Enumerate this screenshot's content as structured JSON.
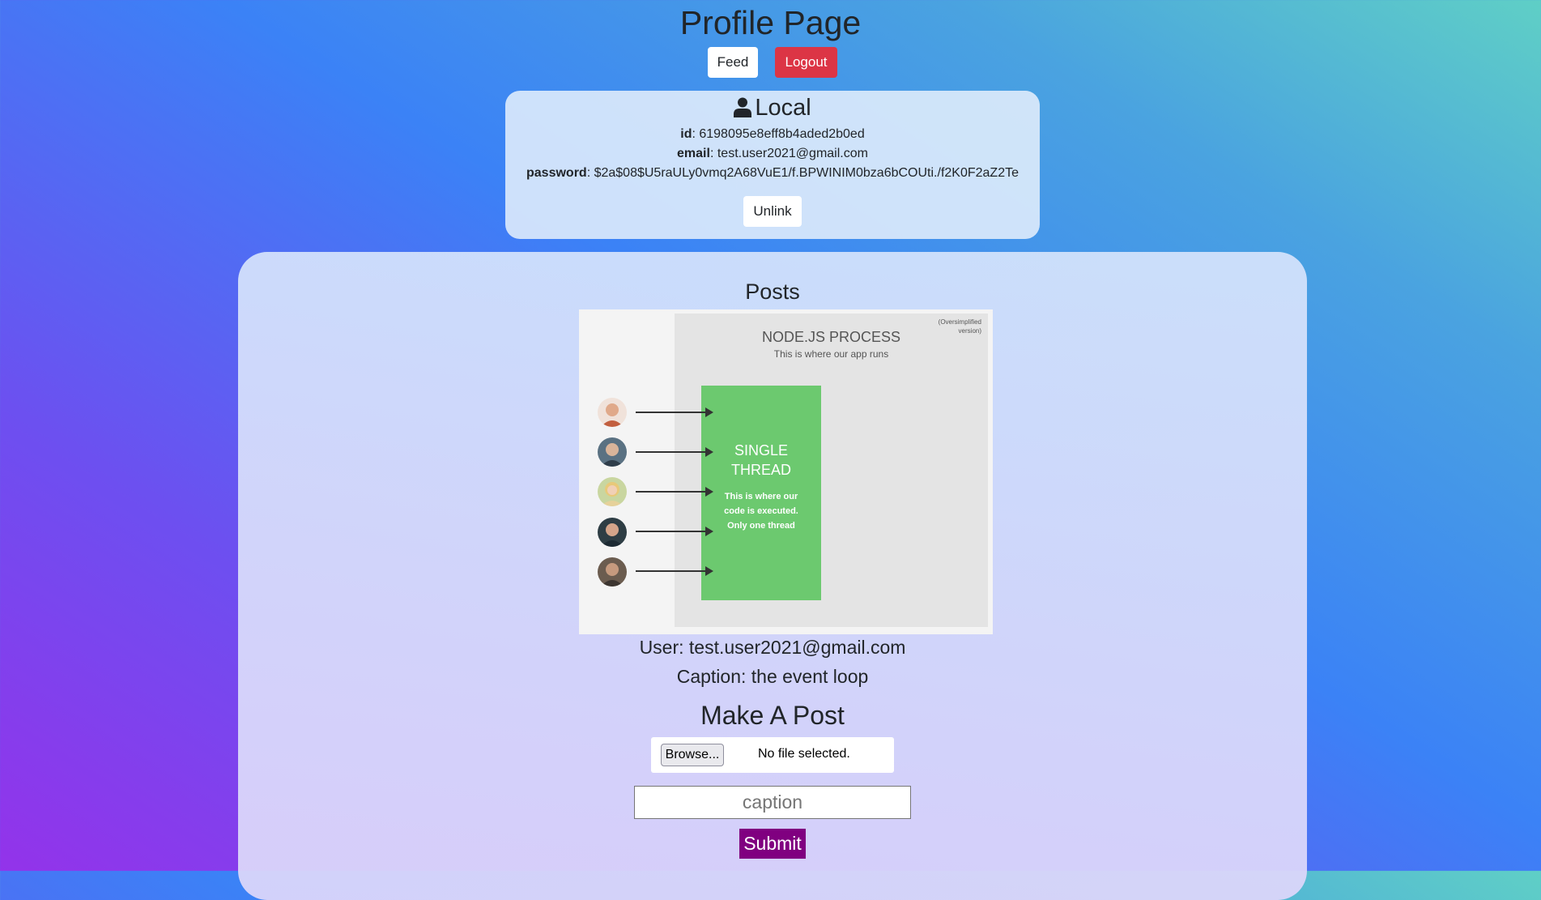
{
  "header": {
    "title": "Profile Page",
    "feed_label": "Feed",
    "logout_label": "Logout"
  },
  "local": {
    "title": "Local",
    "icon": "user-icon",
    "id_label": "id",
    "id_value": "6198095e8eff8b4aded2b0ed",
    "email_label": "email",
    "email_value": "test.user2021@gmail.com",
    "password_label": "password",
    "password_value": "$2a$08$U5raULy0vmq2A68VuE1/f.BPWINIM0bza6bCOUti./f2K0F2aZ2Te",
    "unlink_label": "Unlink"
  },
  "posts": {
    "title": "Posts",
    "items": [
      {
        "image_text": {
          "note": "(Oversimplified version)",
          "process_title": "NODE.JS PROCESS",
          "process_subtitle": "This is where our app runs",
          "thread_title": "SINGLE THREAD",
          "thread_desc": "This is where our code is executed. Only one thread"
        },
        "user_line": "User: test.user2021@gmail.com",
        "caption_line": "Caption: the event loop"
      }
    ]
  },
  "make_post": {
    "title": "Make A Post",
    "browse_label": "Browse...",
    "file_status": "No file selected.",
    "caption_placeholder": "caption",
    "submit_label": "Submit"
  },
  "colors": {
    "logout": "#dc3545",
    "submit": "#800080",
    "thread": "#6cc96f"
  }
}
